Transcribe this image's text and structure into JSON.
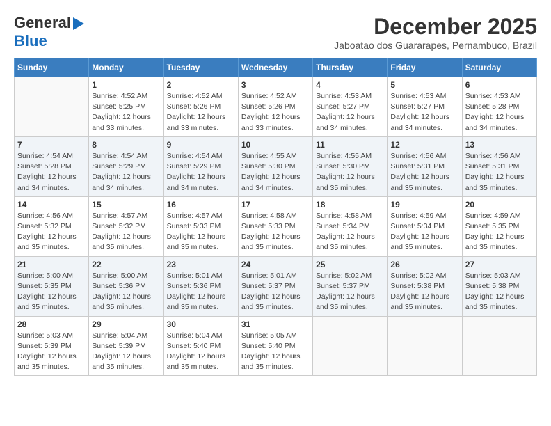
{
  "header": {
    "logo_line1": "General",
    "logo_line2": "Blue",
    "month": "December 2025",
    "location": "Jaboatao dos Guararapes, Pernambuco, Brazil"
  },
  "weekdays": [
    "Sunday",
    "Monday",
    "Tuesday",
    "Wednesday",
    "Thursday",
    "Friday",
    "Saturday"
  ],
  "weeks": [
    [
      {
        "day": "",
        "info": ""
      },
      {
        "day": "1",
        "info": "Sunrise: 4:52 AM\nSunset: 5:25 PM\nDaylight: 12 hours\nand 33 minutes."
      },
      {
        "day": "2",
        "info": "Sunrise: 4:52 AM\nSunset: 5:26 PM\nDaylight: 12 hours\nand 33 minutes."
      },
      {
        "day": "3",
        "info": "Sunrise: 4:52 AM\nSunset: 5:26 PM\nDaylight: 12 hours\nand 33 minutes."
      },
      {
        "day": "4",
        "info": "Sunrise: 4:53 AM\nSunset: 5:27 PM\nDaylight: 12 hours\nand 34 minutes."
      },
      {
        "day": "5",
        "info": "Sunrise: 4:53 AM\nSunset: 5:27 PM\nDaylight: 12 hours\nand 34 minutes."
      },
      {
        "day": "6",
        "info": "Sunrise: 4:53 AM\nSunset: 5:28 PM\nDaylight: 12 hours\nand 34 minutes."
      }
    ],
    [
      {
        "day": "7",
        "info": "Sunrise: 4:54 AM\nSunset: 5:28 PM\nDaylight: 12 hours\nand 34 minutes."
      },
      {
        "day": "8",
        "info": "Sunrise: 4:54 AM\nSunset: 5:29 PM\nDaylight: 12 hours\nand 34 minutes."
      },
      {
        "day": "9",
        "info": "Sunrise: 4:54 AM\nSunset: 5:29 PM\nDaylight: 12 hours\nand 34 minutes."
      },
      {
        "day": "10",
        "info": "Sunrise: 4:55 AM\nSunset: 5:30 PM\nDaylight: 12 hours\nand 34 minutes."
      },
      {
        "day": "11",
        "info": "Sunrise: 4:55 AM\nSunset: 5:30 PM\nDaylight: 12 hours\nand 35 minutes."
      },
      {
        "day": "12",
        "info": "Sunrise: 4:56 AM\nSunset: 5:31 PM\nDaylight: 12 hours\nand 35 minutes."
      },
      {
        "day": "13",
        "info": "Sunrise: 4:56 AM\nSunset: 5:31 PM\nDaylight: 12 hours\nand 35 minutes."
      }
    ],
    [
      {
        "day": "14",
        "info": "Sunrise: 4:56 AM\nSunset: 5:32 PM\nDaylight: 12 hours\nand 35 minutes."
      },
      {
        "day": "15",
        "info": "Sunrise: 4:57 AM\nSunset: 5:32 PM\nDaylight: 12 hours\nand 35 minutes."
      },
      {
        "day": "16",
        "info": "Sunrise: 4:57 AM\nSunset: 5:33 PM\nDaylight: 12 hours\nand 35 minutes."
      },
      {
        "day": "17",
        "info": "Sunrise: 4:58 AM\nSunset: 5:33 PM\nDaylight: 12 hours\nand 35 minutes."
      },
      {
        "day": "18",
        "info": "Sunrise: 4:58 AM\nSunset: 5:34 PM\nDaylight: 12 hours\nand 35 minutes."
      },
      {
        "day": "19",
        "info": "Sunrise: 4:59 AM\nSunset: 5:34 PM\nDaylight: 12 hours\nand 35 minutes."
      },
      {
        "day": "20",
        "info": "Sunrise: 4:59 AM\nSunset: 5:35 PM\nDaylight: 12 hours\nand 35 minutes."
      }
    ],
    [
      {
        "day": "21",
        "info": "Sunrise: 5:00 AM\nSunset: 5:35 PM\nDaylight: 12 hours\nand 35 minutes."
      },
      {
        "day": "22",
        "info": "Sunrise: 5:00 AM\nSunset: 5:36 PM\nDaylight: 12 hours\nand 35 minutes."
      },
      {
        "day": "23",
        "info": "Sunrise: 5:01 AM\nSunset: 5:36 PM\nDaylight: 12 hours\nand 35 minutes."
      },
      {
        "day": "24",
        "info": "Sunrise: 5:01 AM\nSunset: 5:37 PM\nDaylight: 12 hours\nand 35 minutes."
      },
      {
        "day": "25",
        "info": "Sunrise: 5:02 AM\nSunset: 5:37 PM\nDaylight: 12 hours\nand 35 minutes."
      },
      {
        "day": "26",
        "info": "Sunrise: 5:02 AM\nSunset: 5:38 PM\nDaylight: 12 hours\nand 35 minutes."
      },
      {
        "day": "27",
        "info": "Sunrise: 5:03 AM\nSunset: 5:38 PM\nDaylight: 12 hours\nand 35 minutes."
      }
    ],
    [
      {
        "day": "28",
        "info": "Sunrise: 5:03 AM\nSunset: 5:39 PM\nDaylight: 12 hours\nand 35 minutes."
      },
      {
        "day": "29",
        "info": "Sunrise: 5:04 AM\nSunset: 5:39 PM\nDaylight: 12 hours\nand 35 minutes."
      },
      {
        "day": "30",
        "info": "Sunrise: 5:04 AM\nSunset: 5:40 PM\nDaylight: 12 hours\nand 35 minutes."
      },
      {
        "day": "31",
        "info": "Sunrise: 5:05 AM\nSunset: 5:40 PM\nDaylight: 12 hours\nand 35 minutes."
      },
      {
        "day": "",
        "info": ""
      },
      {
        "day": "",
        "info": ""
      },
      {
        "day": "",
        "info": ""
      }
    ]
  ]
}
